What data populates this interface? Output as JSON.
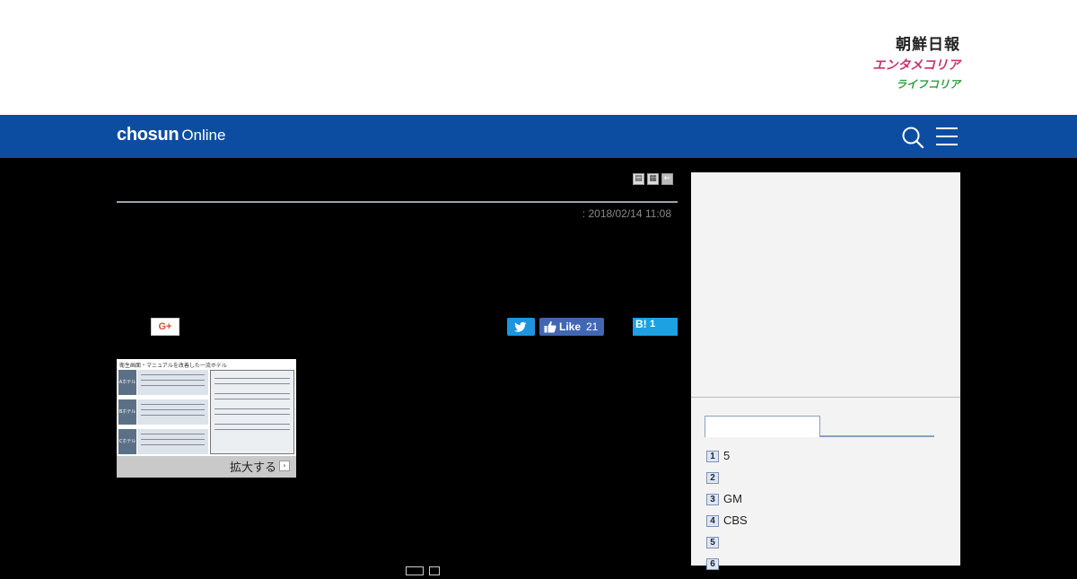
{
  "header": {
    "brand_main": "朝鮮日報",
    "brand_ent": "エンタメコリア",
    "brand_life": "ライフコリア"
  },
  "nav": {
    "logo_bold": "chosun",
    "logo_light": "Online",
    "search_icon": "search-icon",
    "menu_icon": "hamburger-menu-icon",
    "color": "#0c4da2"
  },
  "article": {
    "tools": [
      "print-icon",
      "text-size-icon",
      "back-icon"
    ],
    "dateline": ": 2018/02/14 11:08",
    "social": {
      "gplus_label": "G+",
      "fb_like": "Like",
      "fb_count": "21",
      "hatena_mark": "B!",
      "hatena_count": "1"
    },
    "figure": {
      "title": "衛生画面・マニュアルを改善した一流ホテル",
      "row_labels": [
        "Aホテル",
        "Bホテル",
        "Cホテル"
      ],
      "caption": "拡大する"
    }
  },
  "sidebar": {
    "ranking": [
      {
        "num": "1",
        "text": "5"
      },
      {
        "num": "2",
        "text": ""
      },
      {
        "num": "3",
        "text": "GM"
      },
      {
        "num": "4",
        "text": "CBS"
      },
      {
        "num": "5",
        "text": ""
      },
      {
        "num": "6",
        "text": ""
      }
    ]
  }
}
